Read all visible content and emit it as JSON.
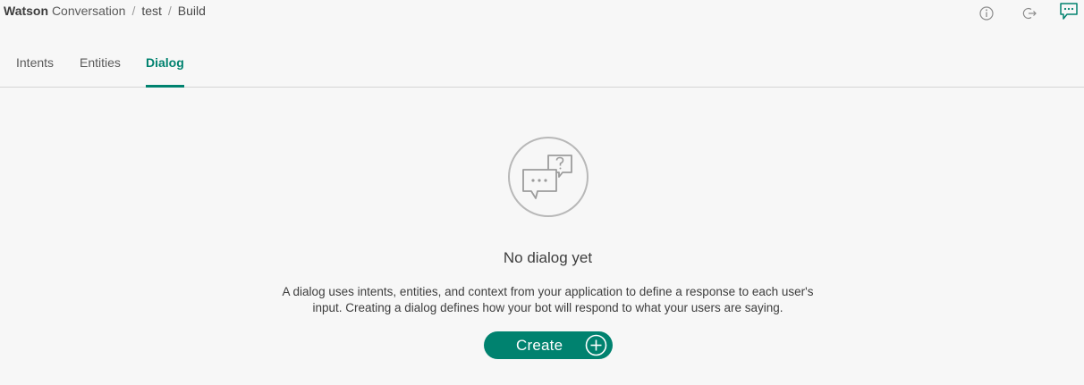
{
  "breadcrumb": {
    "brand_strong": "Watson",
    "brand_rest": "Conversation",
    "separator": "/",
    "workspace": "test",
    "section": "Build"
  },
  "top_icons": [
    {
      "name": "info-icon"
    },
    {
      "name": "logout-icon"
    },
    {
      "name": "chat-icon"
    }
  ],
  "tabs": [
    {
      "label": "Intents",
      "active": false
    },
    {
      "label": "Entities",
      "active": false
    },
    {
      "label": "Dialog",
      "active": true
    }
  ],
  "empty_state": {
    "icon": "chat-bubbles-question-icon",
    "title": "No dialog yet",
    "description_line1": "A dialog uses intents, entities, and context from your application to define a response to each user's",
    "description_line2": "input. Creating a dialog defines how your bot will respond to what your users are saying.",
    "create_label": "Create"
  },
  "colors": {
    "accent": "#00826f",
    "background": "#f7f7f7",
    "divider": "#d5d5d5"
  }
}
